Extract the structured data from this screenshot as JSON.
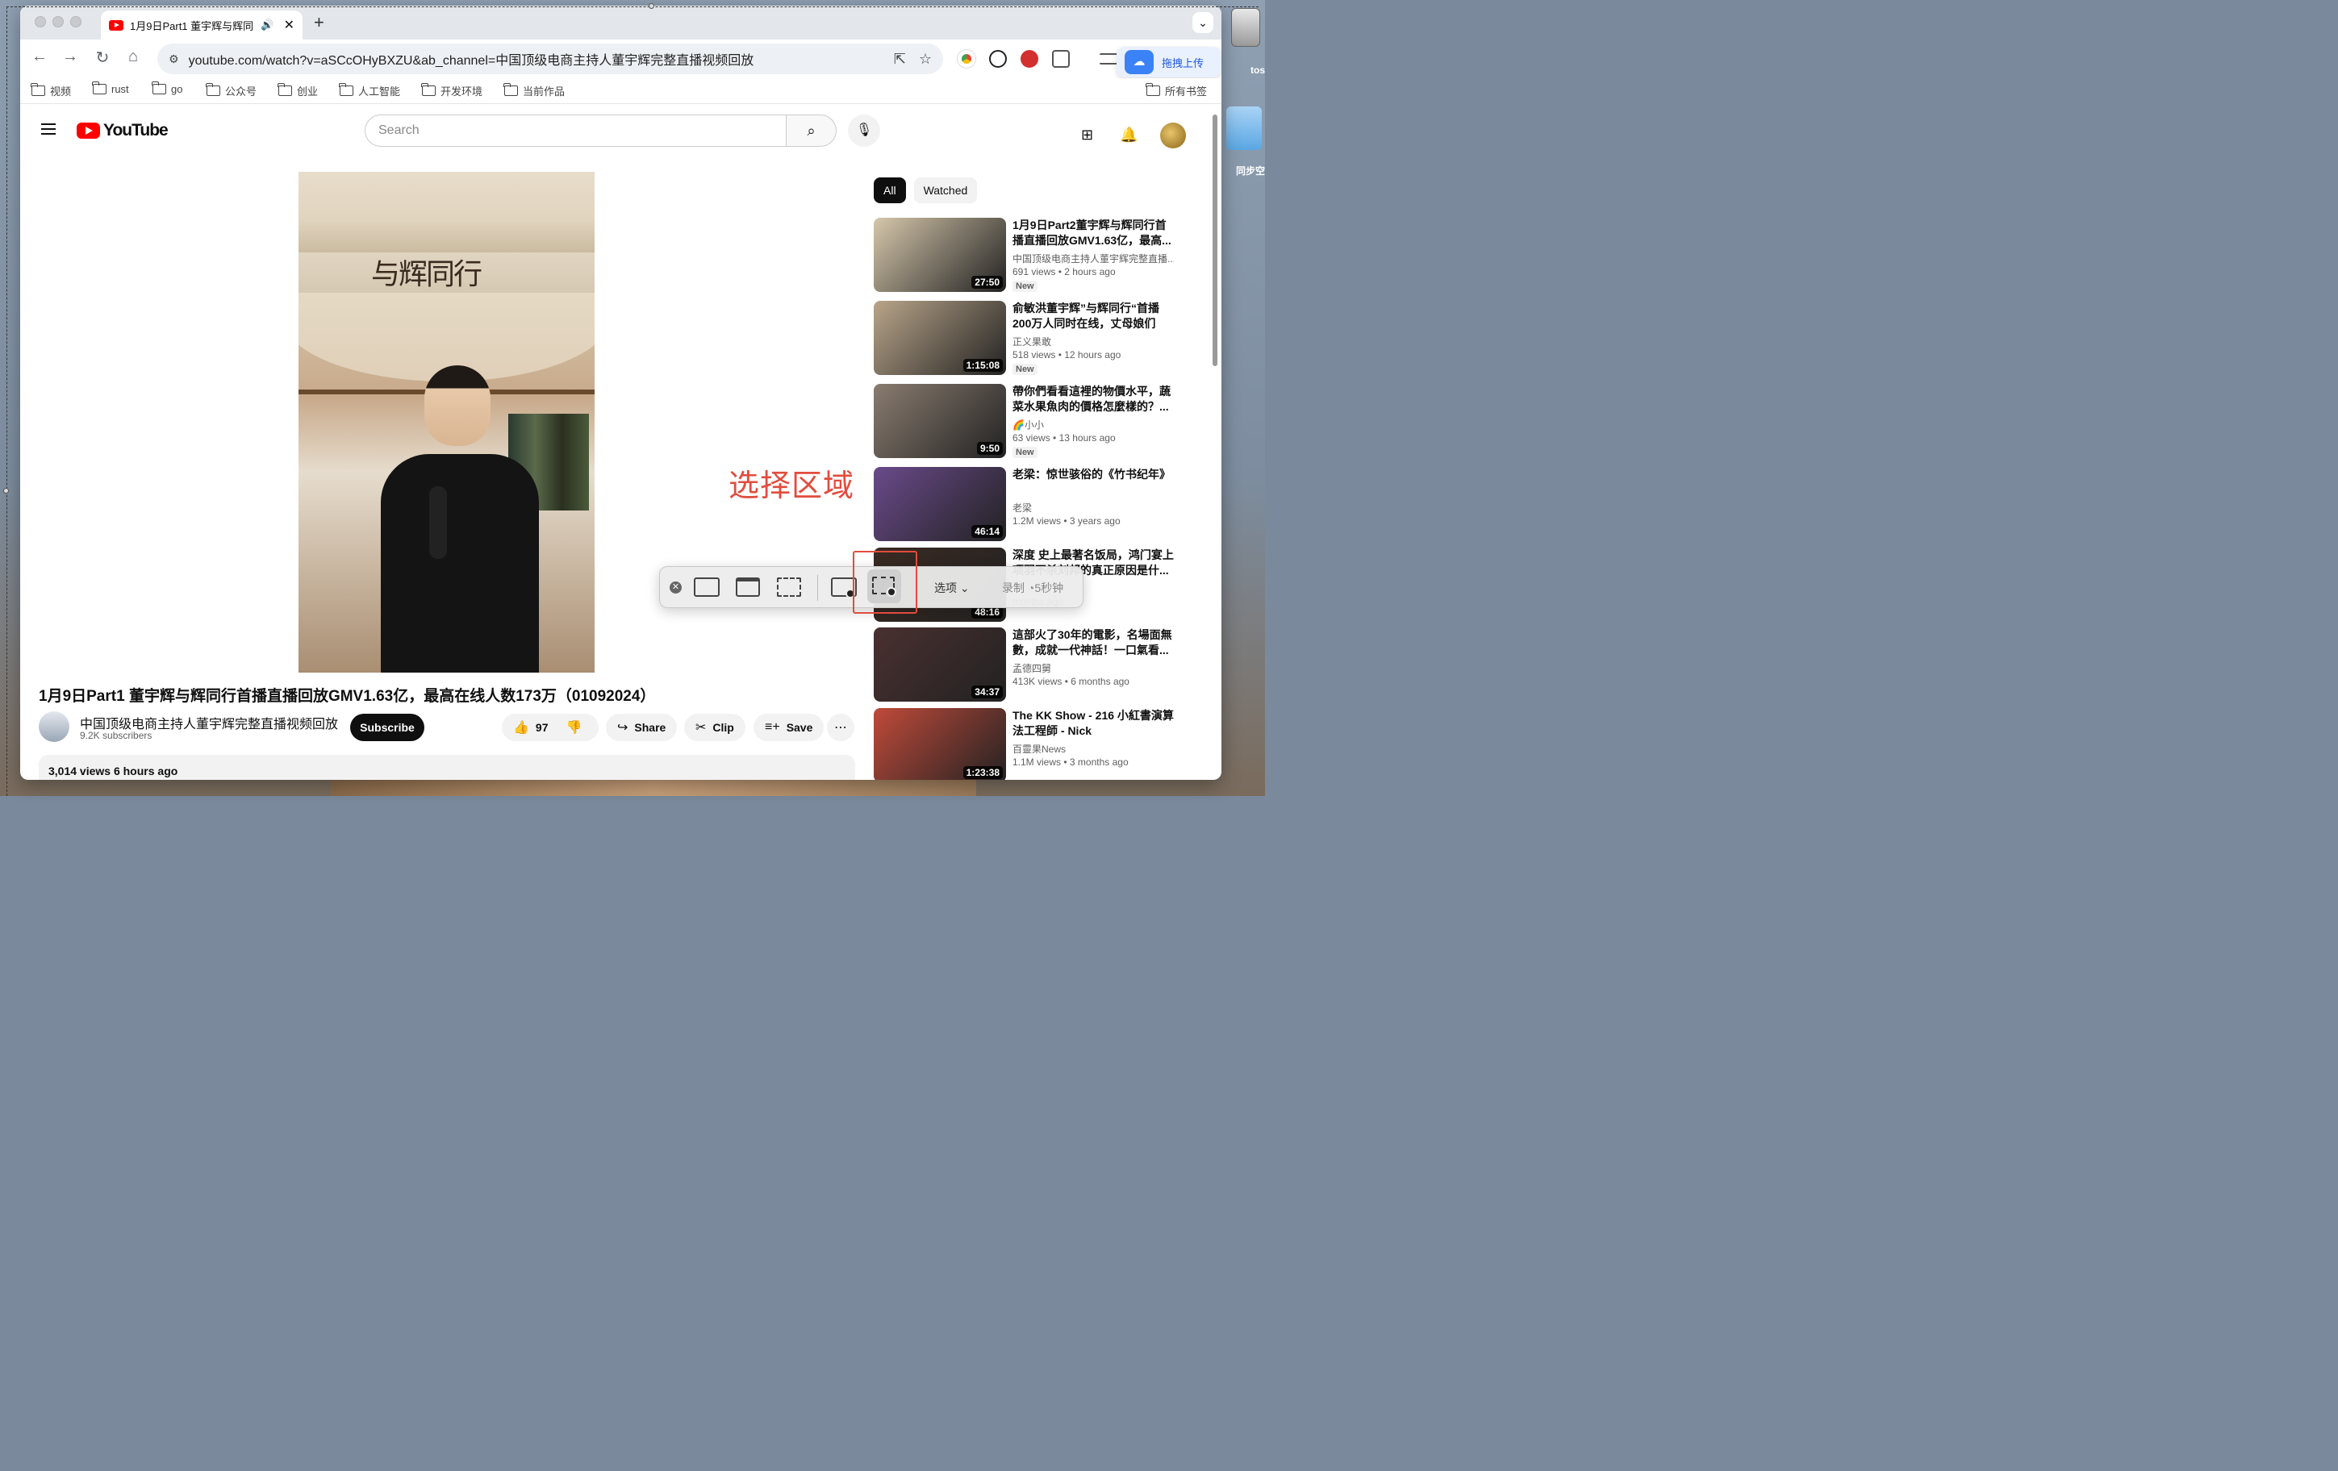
{
  "desktop": {
    "disk_label": "tos",
    "folder_label": "同步空"
  },
  "browser": {
    "tab_title": "1月9日Part1 董宇辉与辉同行",
    "url": "youtube.com/watch?v=aSCcOHyBXZU&ab_channel=中国顶级电商主持人董宇辉完整直播视频回放",
    "upload_label": "拖拽上传",
    "bookmarks": [
      "视频",
      "rust",
      "go",
      "公众号",
      "创业",
      "人工智能",
      "开发环境",
      "当前作品"
    ],
    "all_bookmarks": "所有书签"
  },
  "youtube": {
    "logo_text": "YouTube",
    "search_placeholder": "Search",
    "video": {
      "banner_text": "与辉同行",
      "title": "1月9日Part1 董宇辉与辉同行首播直播回放GMV1.63亿，最高在线人数173万（01092024）",
      "channel": "中国顶级电商主持人董宇辉完整直播视频回放",
      "subscribers": "9.2K subscribers",
      "subscribe": "Subscribe",
      "likes": "97",
      "share": "Share",
      "clip": "Clip",
      "save": "Save",
      "views_time": "3,014 views  6 hours ago"
    },
    "chips": [
      "All",
      "Watched"
    ],
    "recommendations": [
      {
        "title": "1月9日Part2董宇辉与辉同行首播直播回放GMV1.63亿，最高...",
        "channel": "中国顶级电商主持人董宇辉完整直播...",
        "views": "691 views",
        "age": "2 hours ago",
        "badge": "New",
        "duration": "27:50",
        "thumb_color": "#d6c7ab"
      },
      {
        "title": "俞敏洪董宇辉”与辉同行“首播200万人同时在线，丈母娘们太...",
        "channel": "正义果敢",
        "views": "518 views",
        "age": "12 hours ago",
        "badge": "New",
        "duration": "1:15:08",
        "thumb_color": "#b9a58a"
      },
      {
        "title": "帶你們看看這裡的物價水平，蔬菜水果魚肉的價格怎麼樣的？...",
        "channel": "🌈小小",
        "views": "63 views",
        "age": "13 hours ago",
        "badge": "New",
        "duration": "9:50",
        "thumb_color": "#8a7c70"
      },
      {
        "title": "老梁：惊世骇俗的《竹书纪年》",
        "channel": "老梁",
        "views": "1.2M views",
        "age": "3 years ago",
        "badge": "",
        "duration": "46:14",
        "thumb_color": "#6a4a8a"
      },
      {
        "title": "深度 史上最著名饭局，鸿门宴上项羽不杀刘邦的真正原因是什...",
        "channel": "",
        "views": "",
        "age": "months ago",
        "badge": "",
        "duration": "48:16",
        "thumb_color": "#3a2a22"
      },
      {
        "title": "這部火了30年的電影，名場面無數，成就一代神話！一口氣看...",
        "channel": "孟德四舅",
        "views": "413K views",
        "age": "6 months ago",
        "badge": "",
        "duration": "34:37",
        "thumb_color": "#4a3030"
      },
      {
        "title": "The KK Show - 216 小紅書演算法工程師 - Nick",
        "channel": "百靈果News",
        "views": "1.1M views",
        "age": "3 months ago",
        "badge": "",
        "duration": "1:23:38",
        "thumb_color": "#c04a3a"
      }
    ]
  },
  "screenshot_toolbar": {
    "options": "选项",
    "record": "录制",
    "timer": "5秒钟"
  },
  "annotation": {
    "text": "选择区域",
    "color": "#e24c3c"
  }
}
